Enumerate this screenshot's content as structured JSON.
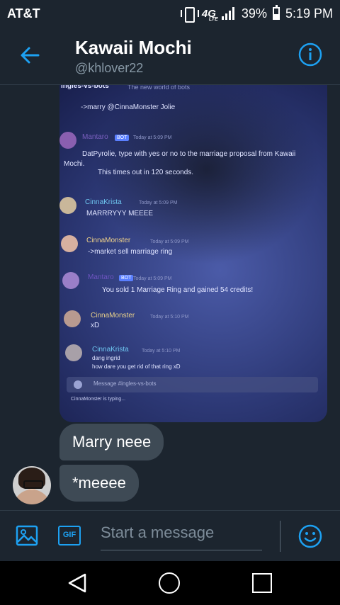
{
  "status_bar": {
    "carrier": "AT&T",
    "network": "4G",
    "network_sub": "LTE",
    "battery": "39%",
    "time": "5:19 PM"
  },
  "header": {
    "name": "Kawaii Mochi",
    "handle": "@khlover22"
  },
  "photo": {
    "channel": "ingles-vs-bots",
    "channel_topic": "The new world of bots",
    "lines": [
      {
        "text": "->marry @CinnaMonster Jolie"
      },
      {
        "user": "Mantaro",
        "badge": "BOT",
        "time": "Today at 5:09 PM"
      },
      {
        "text": "DatPyrolie, type with yes or no to the marriage proposal from Kawaii"
      },
      {
        "text": "Mochi."
      },
      {
        "text": "This times out in 120 seconds."
      },
      {
        "user": "CinnaKrista",
        "time": "Today at 5:09 PM"
      },
      {
        "text": "MARRRYYY MEEEE"
      },
      {
        "user": "CinnaMonster",
        "time": "Today at 5:09 PM"
      },
      {
        "text": "->market sell marriage ring"
      },
      {
        "user": "Mantaro",
        "badge": "BOT",
        "time": "Today at 5:09 PM"
      },
      {
        "text": "You sold 1 Marriage Ring and gained 54 credits!"
      },
      {
        "user": "CinnaMonster",
        "time": "Today at 5:10 PM"
      },
      {
        "text": "xD"
      },
      {
        "user": "CinnaKrista",
        "time": "Today at 5:10 PM"
      },
      {
        "text": "dang ingrid"
      },
      {
        "text": "how dare you get rid of that ring xD"
      }
    ],
    "input_placeholder": "Message #ingles-vs-bots",
    "typing": "CinnaMonster is typing..."
  },
  "messages": [
    {
      "text": "Marry neee"
    },
    {
      "text": "*meeee"
    }
  ],
  "composer": {
    "gif_label": "GIF",
    "placeholder": "Start a message"
  },
  "colors": {
    "accent": "#1da1f2",
    "background": "#1c252f",
    "bubble": "#3e4a55"
  },
  "icons": [
    "back-arrow-icon",
    "info-icon",
    "image-icon",
    "gif-icon",
    "emoji-icon",
    "nav-back-icon",
    "nav-home-icon",
    "nav-recent-icon"
  ]
}
